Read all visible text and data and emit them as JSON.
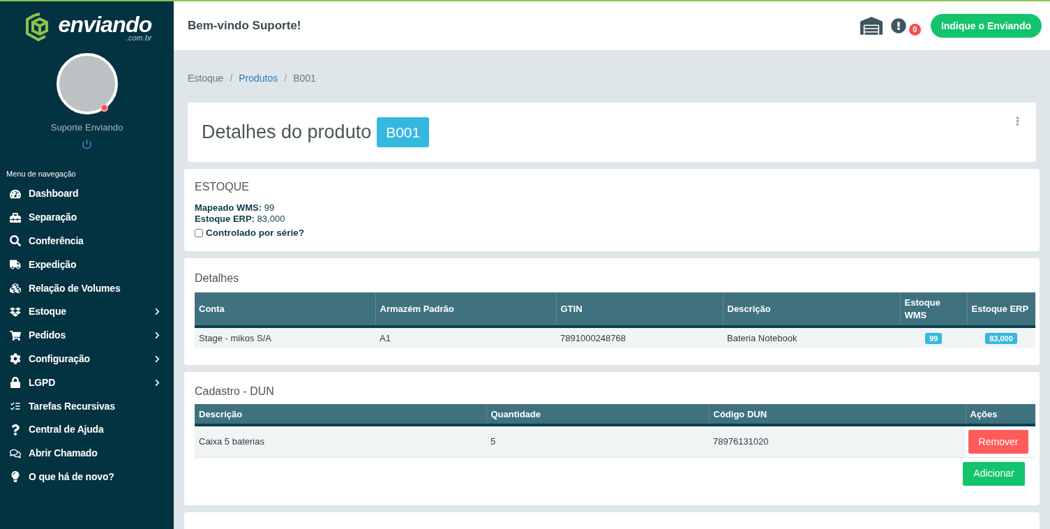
{
  "logo": {
    "name": "enviando",
    "suffix": ".com.br"
  },
  "user": {
    "name": "Suporte Enviando"
  },
  "nav": {
    "heading": "Menu de navegação",
    "items": [
      {
        "label": "Dashboard",
        "submenu": false
      },
      {
        "label": "Separação",
        "submenu": false
      },
      {
        "label": "Conferência",
        "submenu": false
      },
      {
        "label": "Expedição",
        "submenu": false
      },
      {
        "label": "Relação de Volumes",
        "submenu": false
      },
      {
        "label": "Estoque",
        "submenu": true
      },
      {
        "label": "Pedidos",
        "submenu": true
      },
      {
        "label": "Configuração",
        "submenu": true
      },
      {
        "label": "LGPD",
        "submenu": true
      },
      {
        "label": "Tarefas Recursivas",
        "submenu": false
      },
      {
        "label": "Central de Ajuda",
        "submenu": false
      },
      {
        "label": "Abrir Chamado",
        "submenu": false
      },
      {
        "label": "O que há de novo?",
        "submenu": false
      }
    ]
  },
  "header": {
    "greeting": "Bem-vindo Suporte!",
    "notification_count": "0",
    "cta": "Indique o Enviando"
  },
  "breadcrumb": {
    "separator": "/",
    "items": [
      {
        "label": "Estoque",
        "link": false
      },
      {
        "label": "Produtos",
        "link": true
      },
      {
        "label": "B001",
        "link": false
      }
    ]
  },
  "page_title": {
    "title": "Detalhes do produto",
    "badge": "B001"
  },
  "estoque": {
    "title": "ESTOQUE",
    "fields": [
      {
        "label": "Mapeado WMS:",
        "value": "99"
      },
      {
        "label": "Estoque ERP:",
        "value": "83,000"
      }
    ],
    "checkbox": {
      "label": "Controlado por série?",
      "checked": false
    }
  },
  "detalhes": {
    "title": "Detalhes",
    "columns": [
      {
        "label": "Conta",
        "kind": "text"
      },
      {
        "label": "Armazém Padrão",
        "kind": "text"
      },
      {
        "label": "GTIN",
        "kind": "text"
      },
      {
        "label": "Descrição",
        "kind": "text"
      },
      {
        "label": "Estoque WMS",
        "kind": "badge"
      },
      {
        "label": "Estoque ERP",
        "kind": "badge"
      }
    ],
    "rows": [
      {
        "cells": [
          "Stage - mikos S/A",
          "A1",
          "7891000248768",
          "Bateria Notebook",
          "99",
          "83,000"
        ]
      }
    ]
  },
  "dun": {
    "title": "Cadastro - DUN",
    "columns": [
      "Descrição",
      "Quantidade",
      "Código DUN",
      "Ações"
    ],
    "rows": [
      {
        "cells": [
          "Caixa 5 baterias",
          "5",
          "78976131020"
        ],
        "action": "Remover"
      }
    ],
    "add_button": "Adicionar"
  }
}
